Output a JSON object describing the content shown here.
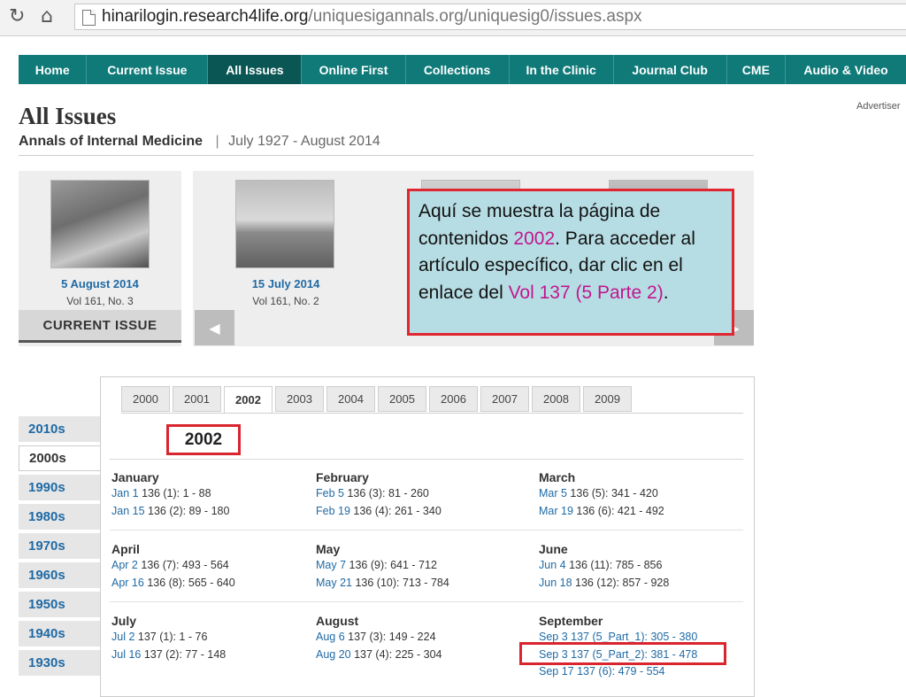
{
  "browser": {
    "url_host": "hinarilogin.research4life.org",
    "url_path": "/uniquesigannals.org/uniquesig0/issues.aspx"
  },
  "nav": [
    {
      "label": "Home",
      "active": false
    },
    {
      "label": "Current Issue",
      "active": false
    },
    {
      "label": "All Issues",
      "active": true
    },
    {
      "label": "Online First",
      "active": false
    },
    {
      "label": "Collections",
      "active": false
    },
    {
      "label": "In the Clinic",
      "active": false
    },
    {
      "label": "Journal Club",
      "active": false
    },
    {
      "label": "CME",
      "active": false
    },
    {
      "label": "Audio & Video",
      "active": false
    }
  ],
  "advert": "Advertiser",
  "page": {
    "title": "All Issues",
    "journal": "Annals of Internal Medicine",
    "separator": "|",
    "range": "July 1927 - August 2014"
  },
  "current_issue": {
    "date": "5 August 2014",
    "vol": "Vol 161, No. 3",
    "button": "CURRENT ISSUE"
  },
  "carousel": {
    "date": "15 July 2014",
    "vol": "Vol 161, No. 2",
    "prev_glyph": "◀",
    "next_glyph": "▶"
  },
  "callout": {
    "p1": "Aquí se muestra la página de contenidos ",
    "h1": "2002",
    "p2": ". Para acceder al artículo específico, dar clic en el enlace del ",
    "h2": "Vol 137 (5 Parte 2)",
    "p3": "."
  },
  "decades": [
    {
      "label": "2010s",
      "active": false
    },
    {
      "label": "2000s",
      "active": true
    },
    {
      "label": "1990s",
      "active": false
    },
    {
      "label": "1980s",
      "active": false
    },
    {
      "label": "1970s",
      "active": false
    },
    {
      "label": "1960s",
      "active": false
    },
    {
      "label": "1950s",
      "active": false
    },
    {
      "label": "1940s",
      "active": false
    },
    {
      "label": "1930s",
      "active": false
    }
  ],
  "years": [
    {
      "label": "2000",
      "active": false
    },
    {
      "label": "2001",
      "active": false
    },
    {
      "label": "2002",
      "active": true
    },
    {
      "label": "2003",
      "active": false
    },
    {
      "label": "2004",
      "active": false
    },
    {
      "label": "2005",
      "active": false
    },
    {
      "label": "2006",
      "active": false
    },
    {
      "label": "2007",
      "active": false
    },
    {
      "label": "2008",
      "active": false
    },
    {
      "label": "2009",
      "active": false
    }
  ],
  "selected_year": "2002",
  "months": [
    {
      "name": "January",
      "issues": [
        {
          "link": "Jan 1",
          "text": " 136 (1): 1 - 88"
        },
        {
          "link": "Jan 15",
          "text": " 136 (2): 89 - 180"
        }
      ]
    },
    {
      "name": "February",
      "issues": [
        {
          "link": "Feb 5",
          "text": " 136 (3): 81 - 260"
        },
        {
          "link": "Feb 19",
          "text": " 136 (4): 261 - 340"
        }
      ]
    },
    {
      "name": "March",
      "issues": [
        {
          "link": "Mar 5",
          "text": " 136 (5): 341 - 420"
        },
        {
          "link": "Mar 19",
          "text": " 136 (6): 421 - 492"
        }
      ]
    },
    {
      "name": "April",
      "issues": [
        {
          "link": "Apr 2",
          "text": " 136 (7): 493 - 564"
        },
        {
          "link": "Apr 16",
          "text": " 136 (8): 565 - 640"
        }
      ]
    },
    {
      "name": "May",
      "issues": [
        {
          "link": "May 7",
          "text": " 136 (9): 641 - 712"
        },
        {
          "link": "May 21",
          "text": " 136 (10): 713 - 784"
        }
      ]
    },
    {
      "name": "June",
      "issues": [
        {
          "link": "Jun 4",
          "text": " 136 (11): 785 - 856"
        },
        {
          "link": "Jun 18",
          "text": " 136 (12): 857 - 928"
        }
      ]
    },
    {
      "name": "July",
      "issues": [
        {
          "link": "Jul 2",
          "text": " 137 (1): 1 - 76"
        },
        {
          "link": "Jul 16",
          "text": " 137 (2): 77 - 148"
        }
      ]
    },
    {
      "name": "August",
      "issues": [
        {
          "link": "Aug 6",
          "text": " 137 (3): 149 - 224"
        },
        {
          "link": "Aug 20",
          "text": " 137 (4): 225 - 304"
        }
      ]
    },
    {
      "name": "September",
      "issues": [
        {
          "link": "Sep 3",
          "text": " 137 (5_Part_1): 305 - 380"
        },
        {
          "link": "Sep 3",
          "text": " 137 (5_Part_2): 381 - 478"
        },
        {
          "link": "Sep 17",
          "text": " 137 (6): 479 - 554"
        }
      ]
    }
  ],
  "colors": {
    "nav": "#0f7a78",
    "link": "#1f6aa5",
    "highlight": "#c0168e",
    "callout_bg": "#b7dde4",
    "annotation": "#d9252e"
  }
}
